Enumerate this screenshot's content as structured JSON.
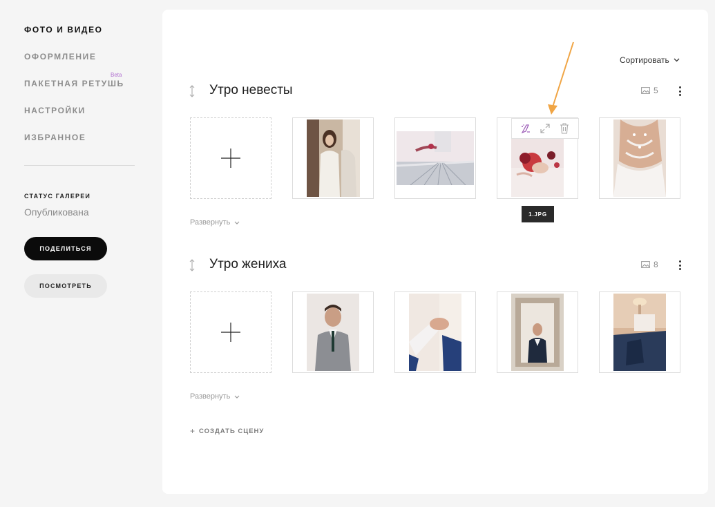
{
  "sidebar": {
    "items": [
      {
        "label": "ФОТО И ВИДЕО",
        "active": true
      },
      {
        "label": "ОФОРМЛЕНИЕ"
      },
      {
        "label": "ПАКЕТНАЯ РЕТУШЬ",
        "badge": "Beta"
      },
      {
        "label": "НАСТРОЙКИ"
      },
      {
        "label": "ИЗБРАННОЕ"
      }
    ],
    "status_title": "СТАТУС ГАЛЕРЕИ",
    "status_value": "Опубликована",
    "share_label": "ПОДЕЛИТЬСЯ",
    "view_label": "ПОСМОТРЕТЬ"
  },
  "main": {
    "sort_label": "Сортировать",
    "scenes": [
      {
        "title": "Утро невесты",
        "count": "5",
        "expand_label": "Развернуть",
        "photos": [
          "bride-mirror",
          "table-setting",
          "rings-flowers",
          "dress-back"
        ]
      },
      {
        "title": "Утро жениха",
        "count": "8",
        "expand_label": "Развернуть",
        "photos": [
          "groom-vest",
          "cufflinks",
          "groom-mirror",
          "suit-bed"
        ]
      }
    ],
    "hover_toolbar": [
      "retouch-icon",
      "expand-icon",
      "trash-icon"
    ],
    "tooltip": "1.JPG",
    "create_scene_label": "СОЗДАТЬ СЦЕНУ"
  },
  "colors": {
    "accent_arrow": "#f0a545",
    "beta": "#b06fd0",
    "primary_button": "#0b0b0b",
    "secondary_button": "#e9e9e9"
  }
}
